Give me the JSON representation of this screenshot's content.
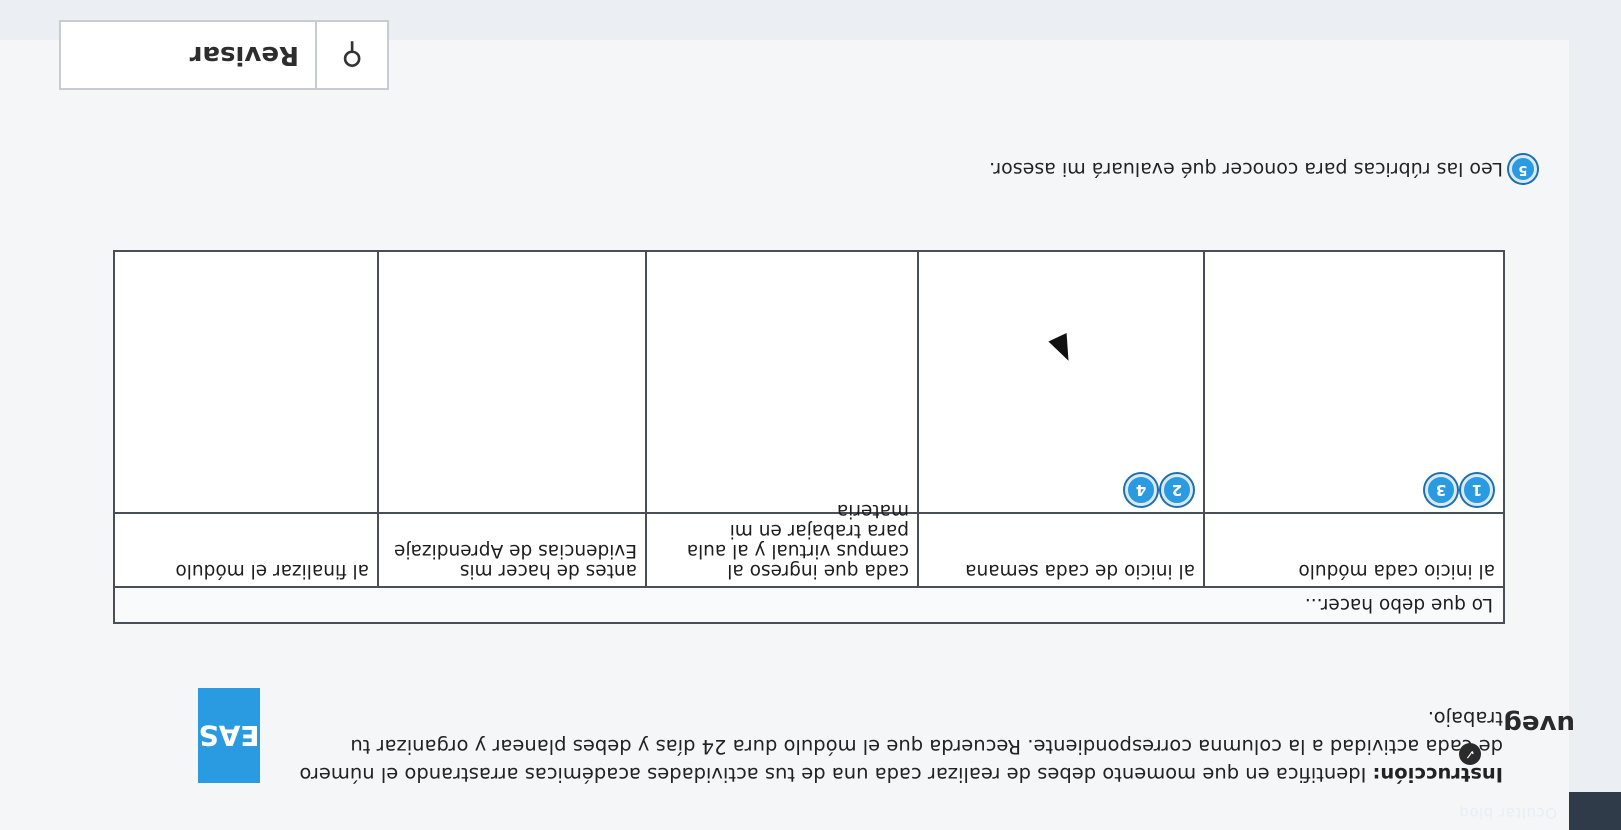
{
  "topbar": {
    "hide_block_label": "Ocultar bloq"
  },
  "logos": {
    "eas": "EAS",
    "uveg": "uveg"
  },
  "instruction": {
    "lead": "Instrucción:",
    "text": " Identifica en que momento debes de realizar cada una de tus actividades académicas arrastrando el número de cada actividad a la columna correspondiente. Recuerda que el módulo dura 24 días y debes planear y organizar tu trabajo."
  },
  "table": {
    "title": "Lo que debo hacer...",
    "columns": [
      "al inicio cada módulo",
      "al inicio de cada semana",
      "cada que ingreso al campus virtual y al aula para trabajar en mi materia",
      "antes de hacer mis Evidencias de Aprendizaje",
      "al finalizar el módulo"
    ],
    "placed": {
      "col1": [
        "1",
        "3"
      ],
      "col2": [
        "2",
        "4"
      ]
    }
  },
  "activities": [
    {
      "number": "5",
      "text": "Leo las rúbricas para conocer qué evaluará mi asesor."
    }
  ],
  "review_button": {
    "label": "Revisar",
    "icon": "search-icon"
  },
  "colors": {
    "accent": "#2a9be0",
    "border": "#4a4f57"
  }
}
